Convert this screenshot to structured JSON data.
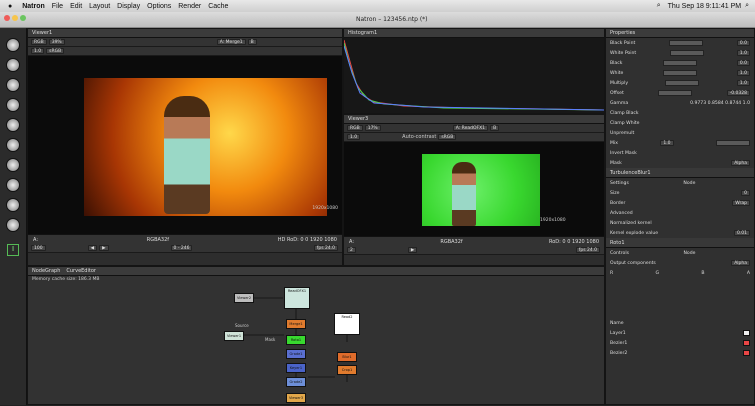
{
  "menubar": {
    "app": "Natron",
    "items": [
      "File",
      "Edit",
      "Layout",
      "Display",
      "Options",
      "Render",
      "Cache"
    ],
    "clock": "Thu Sep 18 9:11:41 PM"
  },
  "window": {
    "title": "Natron – 123456.ntp (*)"
  },
  "viewer1": {
    "tab": "Viewer1",
    "channel": "RGB",
    "zoom": "39%",
    "input_a": "A: Merge1",
    "input_b": "B",
    "left_info": "A:",
    "format_center": "RGBA32f",
    "format_right": "HD RoD: 0 0 1920 1080",
    "overlay_size": "1920x1080",
    "frame": "100",
    "fps": "fps 24.0",
    "range": "0 - 246"
  },
  "histogram": {
    "tab": "Histogram1"
  },
  "viewer3": {
    "tab": "Viewer3",
    "channel": "RGB",
    "zoom": "17%",
    "input_a": "A: ReadOFX1",
    "input_b": "B",
    "auto_contrast": "Auto-contrast",
    "colorspace": "sRGB",
    "left_info": "A:",
    "format_center": "RGBA32f",
    "format_right": "RoD: 0 0 1920 1080",
    "overlay_size": "1920x1080",
    "frame": "2",
    "fps": "fps 24.0"
  },
  "nodegraph": {
    "tab": "NodeGraph",
    "tab2": "CurveEditor",
    "memory": "Memory cache size: 186.3 MB",
    "nodes": [
      {
        "name": "Viewer2",
        "color": "#bdbdbd"
      },
      {
        "name": "ReadOFX1",
        "color": "#8fb8c8"
      },
      {
        "name": "Viewer1",
        "color": "#bdbdbd"
      },
      {
        "name": "Merge1",
        "color": "#7db4cf"
      },
      {
        "name": "Roto1",
        "color": "#5b9e3b"
      },
      {
        "name": "Grade1",
        "color": "#5a6fd0"
      },
      {
        "name": "Keyer1",
        "color": "#4a63c8"
      },
      {
        "name": "Viewer3",
        "color": "#e2a74a"
      },
      {
        "name": "Read2",
        "color": "#ffffff"
      },
      {
        "name": "Blur1",
        "color": "#e06c2b"
      },
      {
        "name": "Crop1",
        "color": "#e07b2e"
      },
      {
        "name": "Grade2",
        "color": "#6d8fd8"
      }
    ],
    "edge_labels": [
      "Source",
      "Mask"
    ]
  },
  "properties": {
    "tab": "Properties",
    "grade_rows": [
      {
        "label": "Black Point",
        "value": "0.0"
      },
      {
        "label": "White Point",
        "value": "1.0"
      },
      {
        "label": "Black",
        "value": "0.0"
      },
      {
        "label": "White",
        "value": "1.0"
      },
      {
        "label": "Multiply",
        "value": "1.0"
      },
      {
        "label": "Offset",
        "value": "-0.0328"
      },
      {
        "label": "Gamma",
        "value": "1.0"
      }
    ],
    "gamma_rgba": "0.9773  0.8584  0.8744  1.0",
    "clamp_black": "Clamp Black",
    "clamp_white": "Clamp White",
    "unpremult": "Unpremult",
    "mix": "Mix",
    "mix_value": "1.0",
    "invert_mask": "Invert Mask",
    "mask": "Mask",
    "mask_channel": "Alpha",
    "turbulence": {
      "name": "TurbulenceBlur1",
      "settings": "Settings",
      "node": "Node",
      "size_label": "Size",
      "size_value": "0",
      "border_label": "Border",
      "border_value": "Wrap",
      "advanced": "Advanced",
      "normalized_label": "Normalized kernel",
      "kernel_label": "Kernel explode value",
      "kernel_value": "0.01"
    },
    "roto": {
      "name": "Roto1",
      "tabs": [
        "Controls",
        "Node"
      ],
      "output_label": "Output components",
      "output_value": "Alpha",
      "checks": [
        "R",
        "G",
        "B",
        "A"
      ],
      "layers_header": [
        "Name"
      ],
      "layers": [
        "Layer1",
        "Bezier1",
        "Bezier2"
      ]
    }
  },
  "colors": {
    "accent": "#e2a74a",
    "green": "#38d82f",
    "orange": "#ff8b00"
  }
}
